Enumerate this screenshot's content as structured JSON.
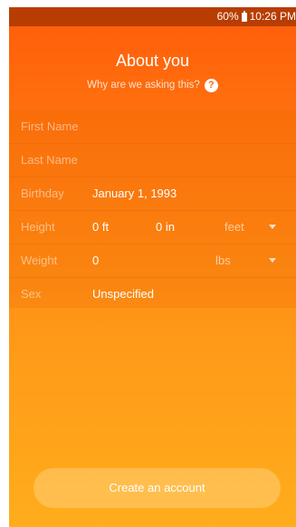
{
  "status_bar": {
    "battery": "60%",
    "time": "10:26 PM"
  },
  "header": {
    "title": "About you",
    "subtitle": "Why are we asking this?",
    "help_glyph": "?"
  },
  "form": {
    "first_name": {
      "label": "First Name",
      "value": ""
    },
    "last_name": {
      "label": "Last Name",
      "value": ""
    },
    "birthday": {
      "label": "Birthday",
      "value": "January 1, 1993"
    },
    "height": {
      "label": "Height",
      "feet": "0 ft",
      "inches": "0 in",
      "unit": "feet"
    },
    "weight": {
      "label": "Weight",
      "value": "0",
      "unit": "lbs"
    },
    "sex": {
      "label": "Sex",
      "value": "Unspecified"
    }
  },
  "cta": {
    "label": "Create an account"
  },
  "icons": {
    "battery": "battery-icon",
    "help": "help-icon",
    "dropdown": "caret-down-icon"
  },
  "colors": {
    "status_bar": "#b83d02",
    "gradient_top": "#ff5c0a",
    "gradient_bottom": "#ffad1c"
  }
}
